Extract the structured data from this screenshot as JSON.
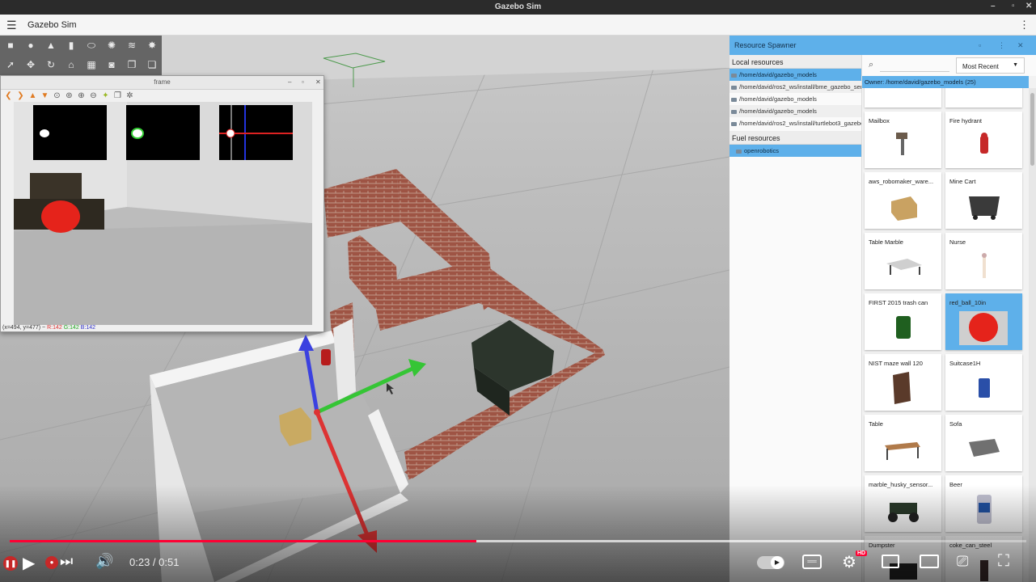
{
  "os": {
    "title": "Gazebo Sim",
    "ctl_min": "–",
    "ctl_max": "▫",
    "ctl_close": "✕"
  },
  "header": {
    "title": "Gazebo Sim",
    "menu_icon": "hamburger-icon",
    "more_icon": "kebab-icon"
  },
  "toolbar": {
    "row1": [
      "box-icon",
      "sphere-icon",
      "cone-icon",
      "cylinder-icon",
      "capsule-icon",
      "sun-icon",
      "directional-light-icon",
      "spot-light-icon"
    ],
    "row2": [
      "select-icon",
      "translate-icon",
      "rotate-icon",
      "snap-icon",
      "grid-icon",
      "camera-icon",
      "copy-icon",
      "paste-icon"
    ]
  },
  "frame_window": {
    "title": "frame",
    "status_prefix": "(x=494, y=477) ~",
    "r": "R:142",
    "g": "G:142",
    "b": "B:142"
  },
  "spawner": {
    "title": "Resource Spawner",
    "local_heading": "Local resources",
    "local_items": [
      "/home/david/gazebo_models",
      "/home/david/ros2_ws/install/bme_gazebo_sensors/share",
      "/home/david/gazebo_models",
      "/home/david/gazebo_models",
      "/home/david/ros2_ws/install/turtlebot3_gazebo/share"
    ],
    "fuel_heading": "Fuel resources",
    "fuel_items": [
      "openrobotics"
    ],
    "search_placeholder": "",
    "sort_value": "Most Recent",
    "owner_label": "Owner: /home/david/gazebo_models (25)",
    "cards": [
      {
        "name": "",
        "selected": false
      },
      {
        "name": "",
        "selected": false
      },
      {
        "name": "Mailbox",
        "selected": false
      },
      {
        "name": "Fire hydrant",
        "selected": false
      },
      {
        "name": "aws_robomaker_ware...",
        "selected": false
      },
      {
        "name": "Mine Cart",
        "selected": false
      },
      {
        "name": "Table Marble",
        "selected": false
      },
      {
        "name": "Nurse",
        "selected": false
      },
      {
        "name": "FIRST 2015 trash can",
        "selected": false
      },
      {
        "name": "red_ball_10in",
        "selected": true
      },
      {
        "name": "NIST maze wall 120",
        "selected": false
      },
      {
        "name": "Suitcase1H",
        "selected": false
      },
      {
        "name": "Table",
        "selected": false
      },
      {
        "name": "Sofa",
        "selected": false
      },
      {
        "name": "marble_husky_sensor...",
        "selected": false
      },
      {
        "name": "Beer",
        "selected": false
      },
      {
        "name": "Dumpster",
        "selected": false
      },
      {
        "name": "coke_can_steel",
        "selected": false
      }
    ]
  },
  "player": {
    "time_display": "0:23 / 0:51",
    "progress_played": 0.4589,
    "progress_buffered": 0.84,
    "hd_badge": "HD",
    "accent": "#ff0033"
  }
}
